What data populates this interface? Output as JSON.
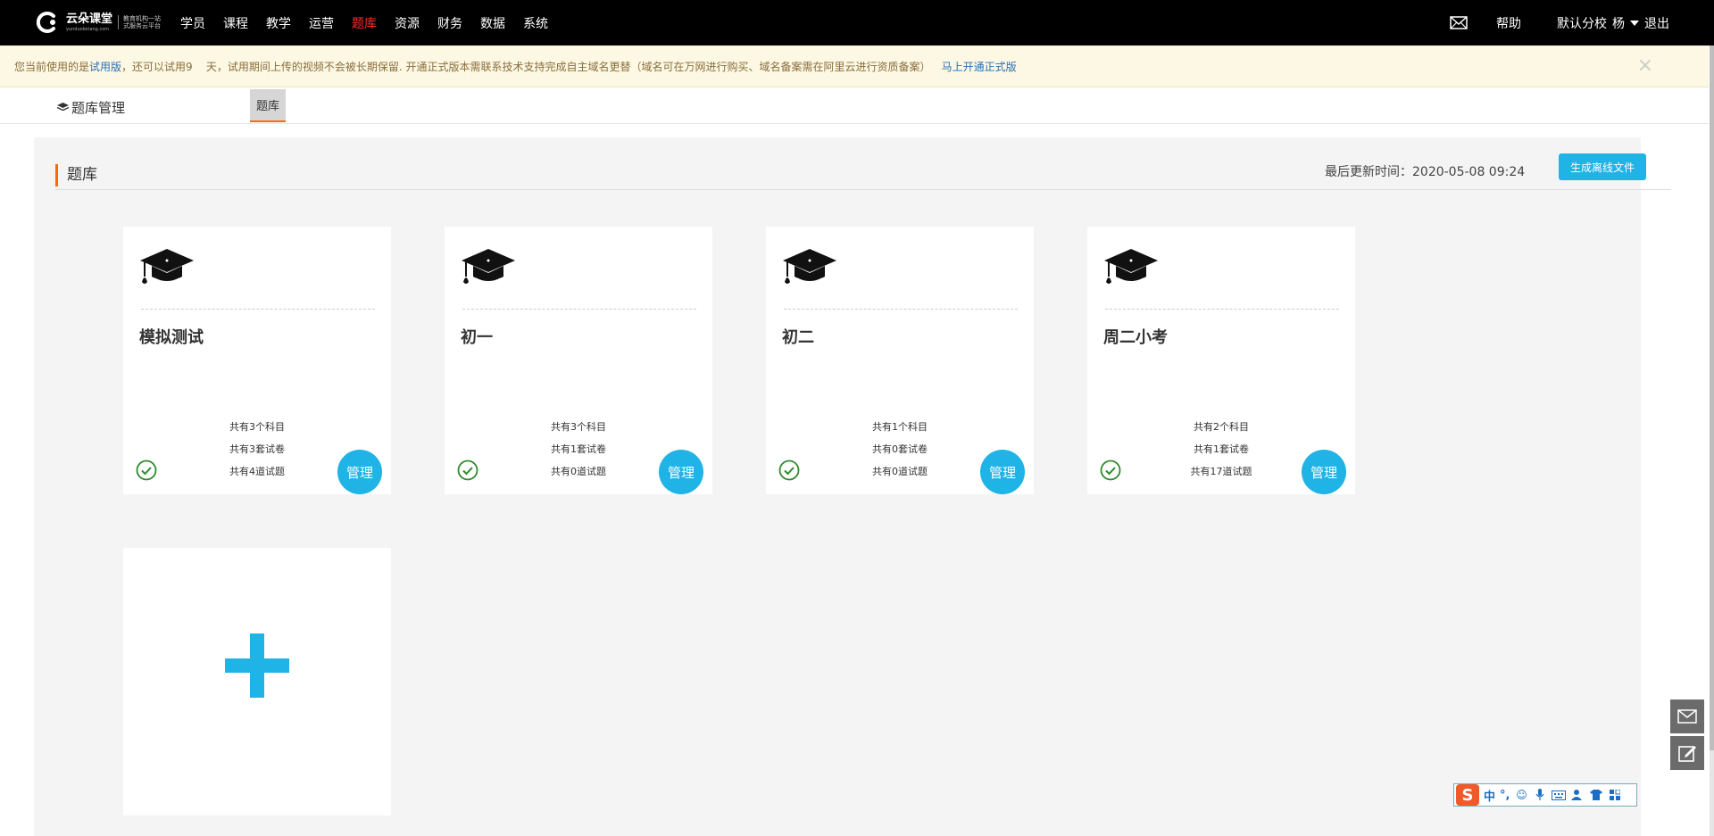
{
  "header": {
    "logo_text": "云朵课堂",
    "logo_sub_line1": "教育机构一站",
    "logo_sub_line2": "式服务云平台",
    "logo_url": "yunduoketang.com",
    "nav": [
      {
        "label": "学员",
        "active": false
      },
      {
        "label": "课程",
        "active": false
      },
      {
        "label": "教学",
        "active": false
      },
      {
        "label": "运营",
        "active": false
      },
      {
        "label": "题库",
        "active": true
      },
      {
        "label": "资源",
        "active": false
      },
      {
        "label": "财务",
        "active": false
      },
      {
        "label": "数据",
        "active": false
      },
      {
        "label": "系统",
        "active": false
      }
    ],
    "help": "帮助",
    "school": "默认分校",
    "user": "杨",
    "logout": "退出"
  },
  "notice": {
    "prefix": "您当前使用的是",
    "version": "试用版",
    "middle": "，还可以试用9    天，试用期间上传的视频不会被长期保留. 开通正式版本需联系技术支持完成自主域名更替（域名可在万网进行购买、域名备案需在阿里云进行资质备案）",
    "cta": "马上开通正式版",
    "close": "×"
  },
  "subbar": {
    "breadcrumb": "题库管理",
    "tab": "题库"
  },
  "main": {
    "title": "题库",
    "updated_label": "最后更新时间：2020-05-08 09:24",
    "generate_button": "生成离线文件",
    "manage_label": "管理",
    "cards": [
      {
        "title": "模拟测试",
        "subjects": "共有3个科目",
        "papers": "共有3套试卷",
        "questions": "共有4道试题"
      },
      {
        "title": "初一",
        "subjects": "共有3个科目",
        "papers": "共有1套试卷",
        "questions": "共有0道试题"
      },
      {
        "title": "初二",
        "subjects": "共有1个科目",
        "papers": "共有0套试卷",
        "questions": "共有0道试题"
      },
      {
        "title": "周二小考",
        "subjects": "共有2个科目",
        "papers": "共有1套试卷",
        "questions": "共有17道试题"
      }
    ]
  },
  "ime": {
    "logo": "S",
    "mode": "中",
    "punct": "°,"
  },
  "colors": {
    "accent": "#1fb3e6",
    "nav_active": "#ff2d2d",
    "section_marker": "#ff6a00",
    "check": "#2e8b2e",
    "notice_bg": "#fcf8e3"
  }
}
